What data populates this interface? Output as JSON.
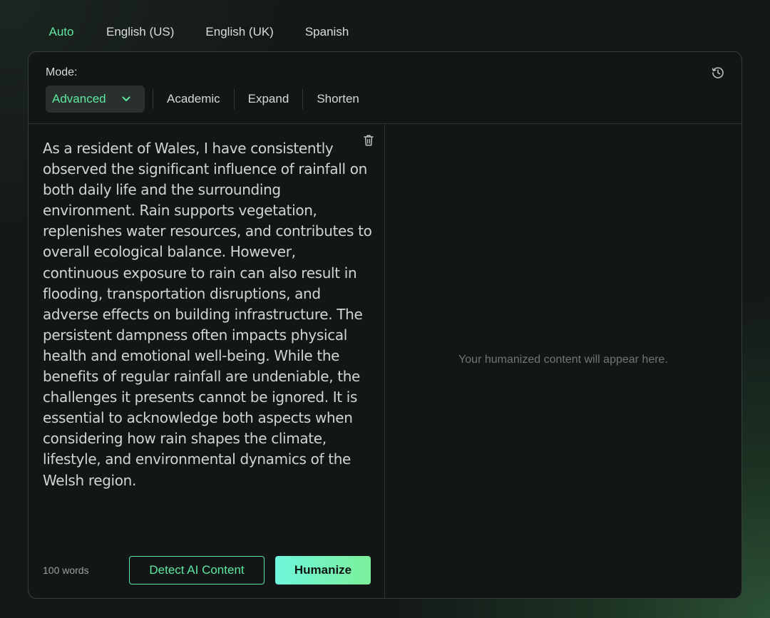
{
  "language_tabs": [
    {
      "label": "Auto",
      "active": true
    },
    {
      "label": "English (US)",
      "active": false
    },
    {
      "label": "English (UK)",
      "active": false
    },
    {
      "label": "Spanish",
      "active": false
    }
  ],
  "mode": {
    "label": "Mode:",
    "selected": "Advanced",
    "options": [
      "Academic",
      "Expand",
      "Shorten"
    ]
  },
  "input": {
    "text": "As a resident of Wales, I have consistently observed the significant influence of rainfall on both daily life and the surrounding environment. Rain supports vegetation, replenishes water resources, and contributes to overall ecological balance. However, continuous exposure to rain can also result in flooding, transportation disruptions, and adverse effects on building infrastructure. The persistent dampness often impacts physical health and emotional well-being. While the benefits of regular rainfall are undeniable, the challenges it presents cannot be ignored. It is essential to acknowledge both aspects when considering how rain shapes the climate, lifestyle, and environmental dynamics of the Welsh region.",
    "word_count": "100 words"
  },
  "actions": {
    "detect_label": "Detect AI Content",
    "humanize_label": "Humanize"
  },
  "output": {
    "placeholder": "Your humanized content will appear here."
  },
  "icons": {
    "history": "history-icon",
    "trash": "trash-icon",
    "dropdown": "chevron-down-icon"
  },
  "colors": {
    "accent": "#5ee8a0",
    "humanize_gradient_start": "#6ff6dc",
    "humanize_gradient_end": "#7bf09a",
    "card_bg": "#121617"
  }
}
